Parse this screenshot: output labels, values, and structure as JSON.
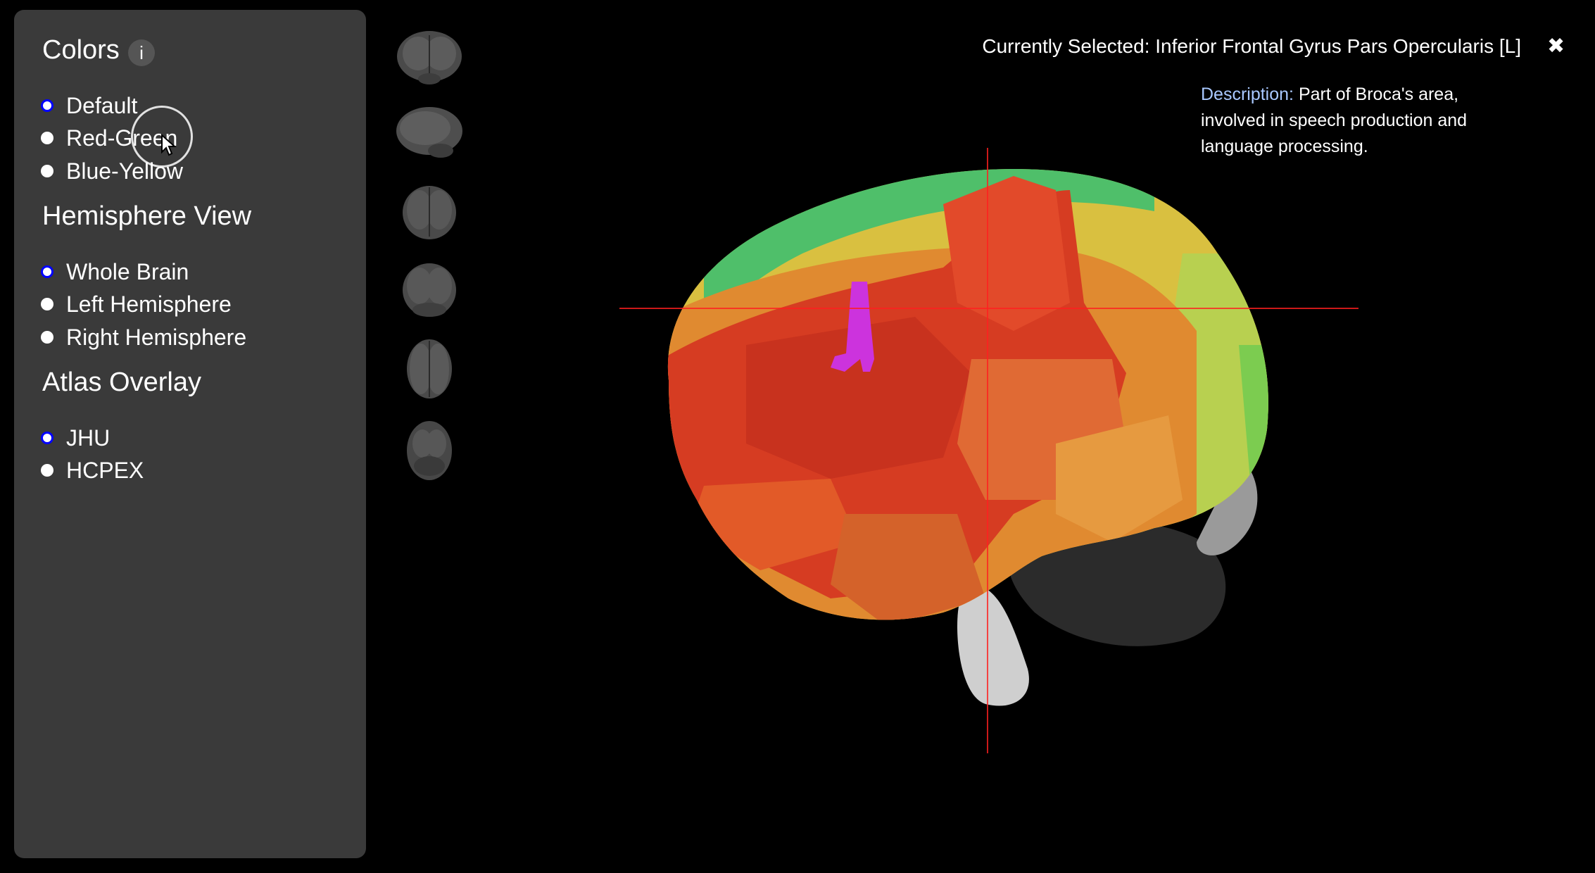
{
  "sidebar": {
    "colors": {
      "title": "Colors",
      "info": "i",
      "options": [
        {
          "label": "Default",
          "selected": true
        },
        {
          "label": "Red-Green",
          "selected": false
        },
        {
          "label": "Blue-Yellow",
          "selected": false
        }
      ]
    },
    "hemisphere": {
      "title": "Hemisphere View",
      "options": [
        {
          "label": "Whole Brain",
          "selected": true
        },
        {
          "label": "Left Hemisphere",
          "selected": false
        },
        {
          "label": "Right Hemisphere",
          "selected": false
        }
      ]
    },
    "atlas": {
      "title": "Atlas Overlay",
      "options": [
        {
          "label": "JHU",
          "selected": true
        },
        {
          "label": "HCPEX",
          "selected": false
        }
      ]
    }
  },
  "thumbnails": [
    "brain-view-front",
    "brain-view-back",
    "brain-view-left",
    "brain-view-right",
    "brain-view-top",
    "brain-view-bottom"
  ],
  "selection": {
    "current": "Currently Selected: Inferior Frontal Gyrus Pars Opercularis [L]",
    "close_icon": "close-icon",
    "description_label": "Description:",
    "description_text": "Part of Broca's area, involved in speech production and language processing."
  },
  "colors": {
    "panel": "#3a3a3a",
    "radio_selected": "#0000ff",
    "description_label": "#a9c8ff",
    "highlight_region": "#cc33dd",
    "crosshair": "#ff2020"
  }
}
